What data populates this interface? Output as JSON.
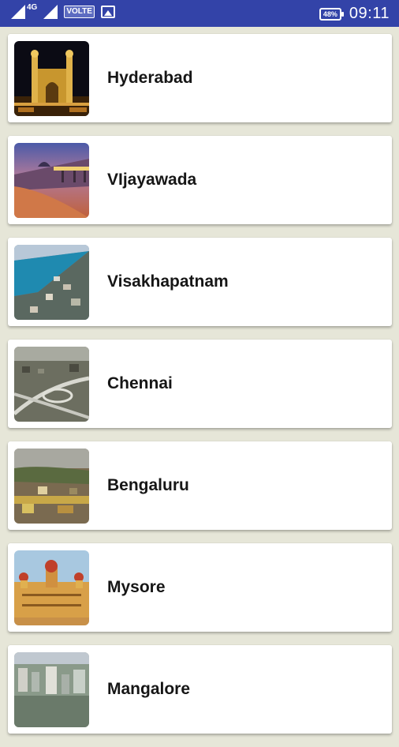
{
  "status_bar": {
    "network": "4G",
    "volte": "VOLTE",
    "battery": "48%",
    "time": "09:11"
  },
  "cities": [
    {
      "name": "Hyderabad",
      "image": "charminar-night"
    },
    {
      "name": "VIjayawada",
      "image": "riverfront-dusk"
    },
    {
      "name": "Visakhapatnam",
      "image": "coastal-city"
    },
    {
      "name": "Chennai",
      "image": "flyover-aerial"
    },
    {
      "name": "Bengaluru",
      "image": "city-skyline"
    },
    {
      "name": "Mysore",
      "image": "mysore-palace"
    },
    {
      "name": "Mangalore",
      "image": "city-aerial"
    }
  ]
}
